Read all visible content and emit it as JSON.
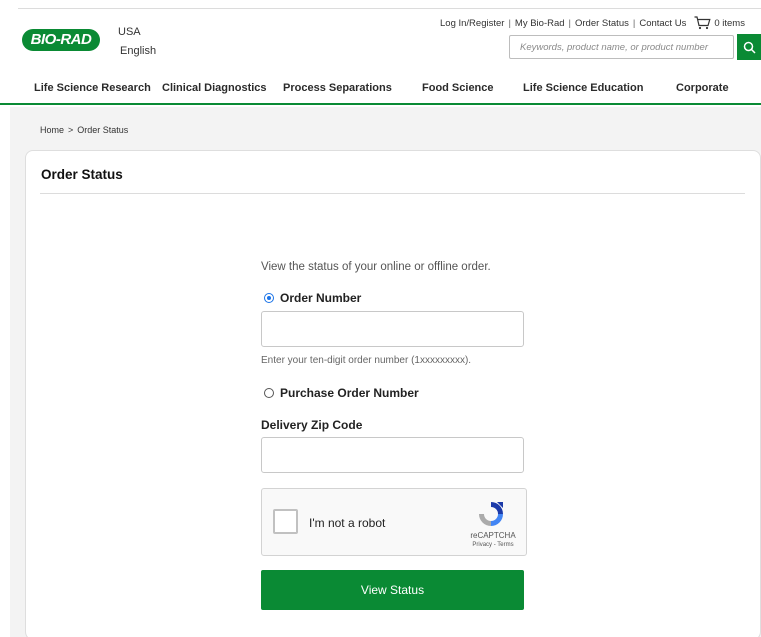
{
  "header": {
    "logo_text": "BIO-RAD",
    "country": "USA",
    "language": "English",
    "util_links": [
      "Log In/Register",
      "My Bio-Rad",
      "Order Status",
      "Contact Us"
    ],
    "cart_label": "0 items",
    "search_placeholder": "Keywords, product name, or product number",
    "brand_color": "#0a8a34"
  },
  "nav": {
    "items": [
      "Life Science Research",
      "Clinical Diagnostics",
      "Process Separations",
      "Food Science",
      "Life Science Education",
      "Corporate"
    ]
  },
  "breadcrumb": {
    "home": "Home",
    "separator": ">",
    "current": "Order Status"
  },
  "main": {
    "title": "Order Status",
    "intro": "View the status of your online or offline order.",
    "order_number_label": "Order Number",
    "order_number_value": "",
    "order_number_hint": "Enter your ten-digit order number (1xxxxxxxxx).",
    "po_number_label": "Purchase Order Number",
    "zip_label": "Delivery Zip Code",
    "zip_value": "",
    "selected_option": "Order Number",
    "submit_label": "View Status"
  },
  "captcha": {
    "label": "I'm not a robot",
    "brand": "reCAPTCHA",
    "terms": "Privacy - Terms"
  }
}
